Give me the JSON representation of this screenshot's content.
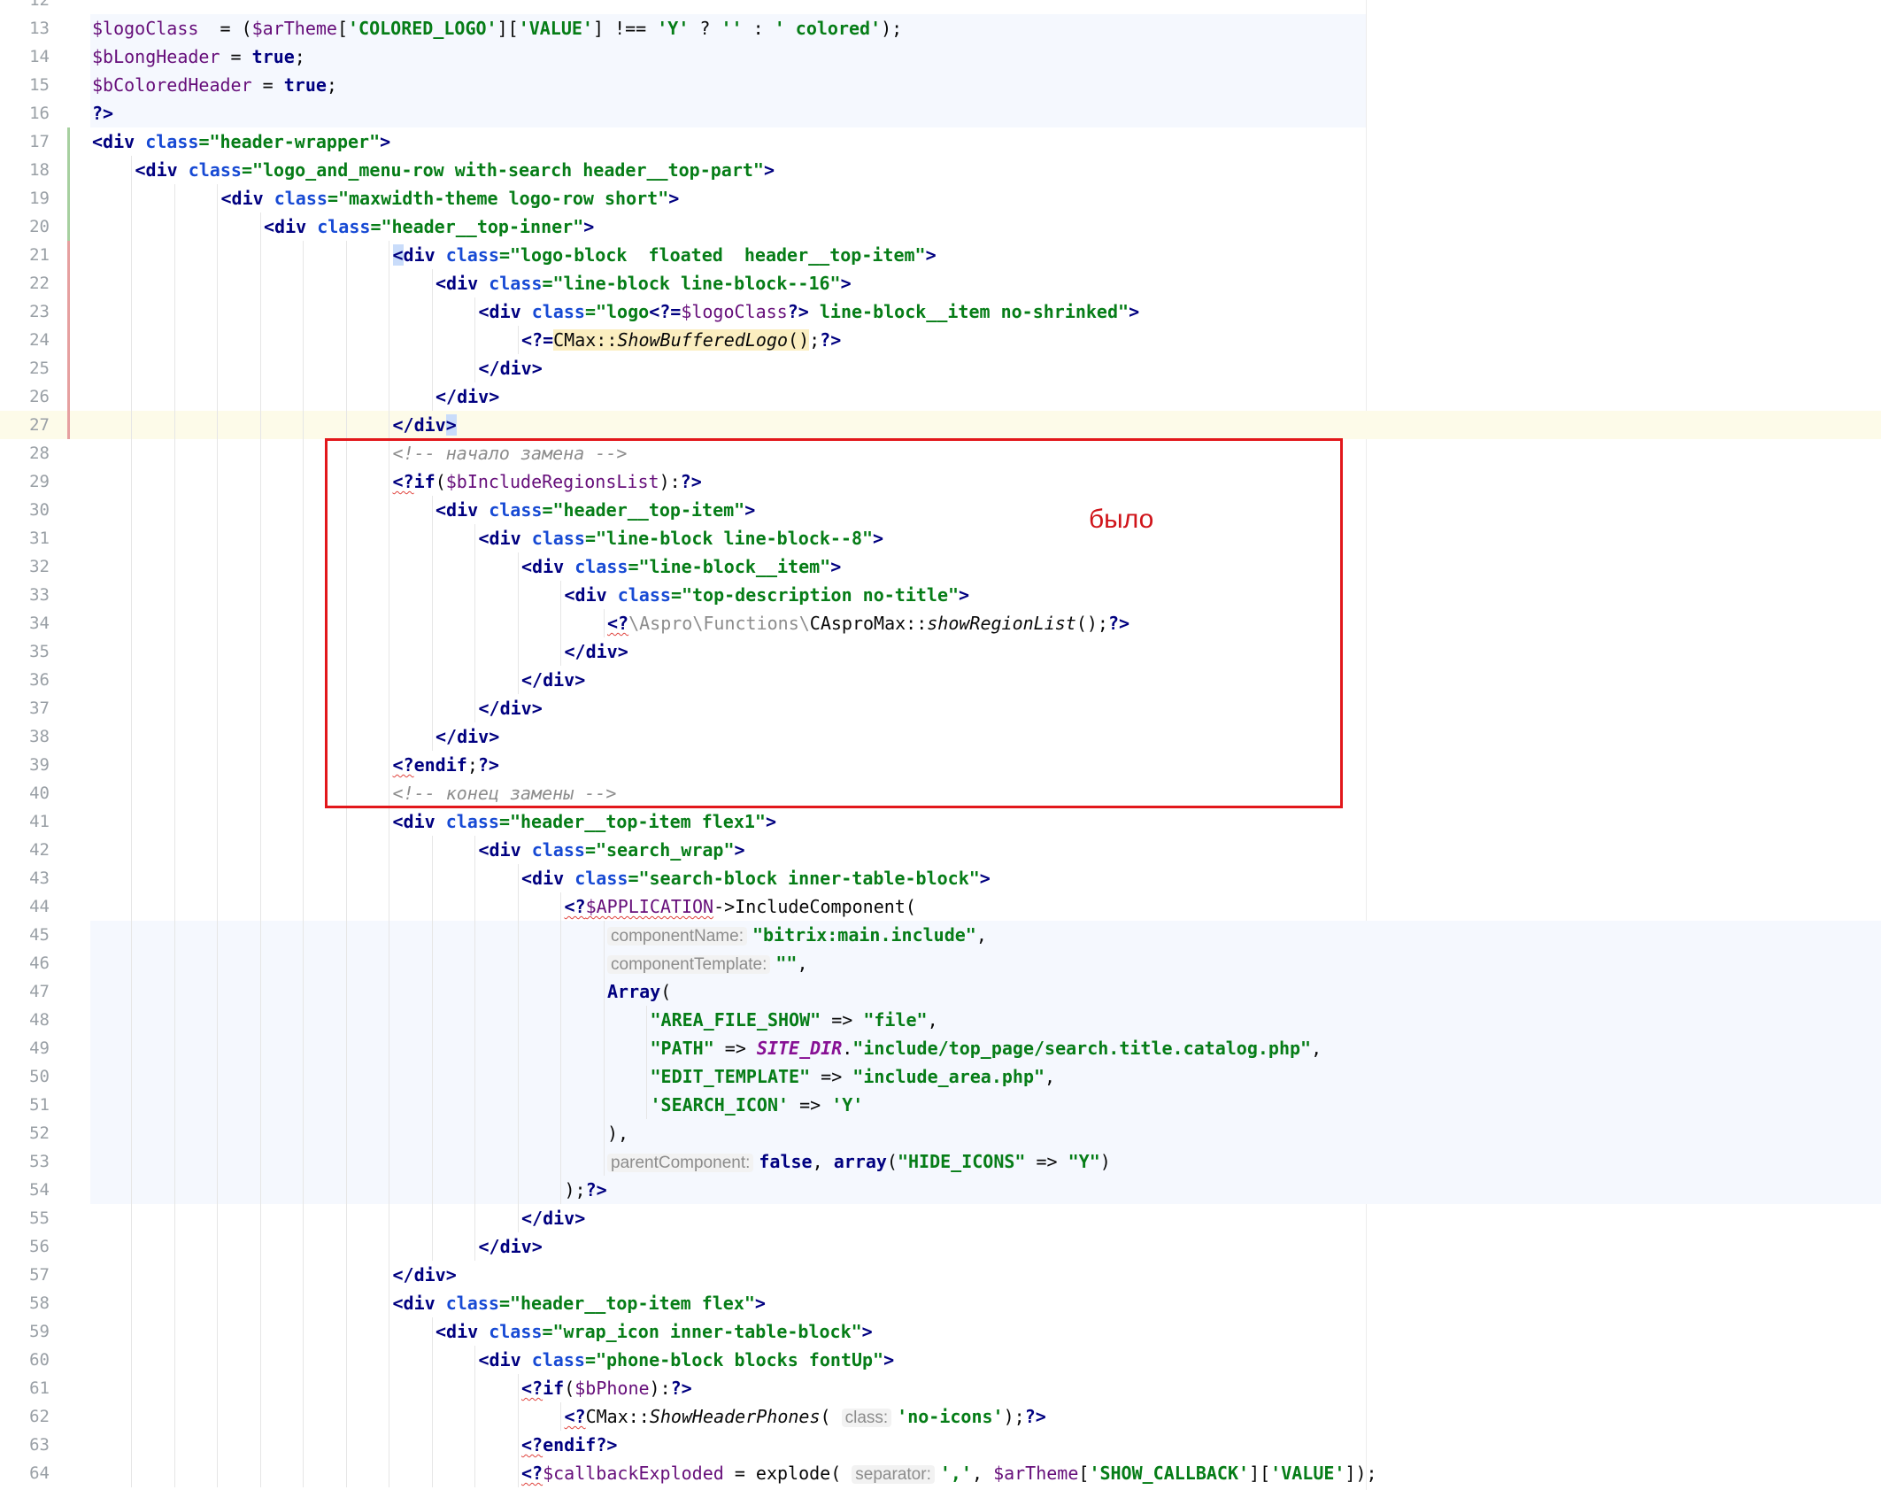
{
  "editor": {
    "annotation_label": "было",
    "lines": [
      {
        "n": "12",
        "indent": 0,
        "tokens": []
      },
      {
        "n": "13",
        "indent": 0,
        "tokens": [
          [
            "t-var",
            "$logoClass"
          ],
          [
            "",
            "  = ("
          ],
          [
            "t-var",
            "$arTheme"
          ],
          [
            "",
            "["
          ],
          [
            "t-str",
            "'COLORED_LOGO'"
          ],
          [
            "",
            "]["
          ],
          [
            "t-str",
            "'VALUE'"
          ],
          [
            "",
            "] !== "
          ],
          [
            "t-str",
            "'Y'"
          ],
          [
            "",
            " ? "
          ],
          [
            "t-str",
            "''"
          ],
          [
            "",
            " : "
          ],
          [
            "t-str",
            "' colored'"
          ],
          [
            "",
            ");"
          ]
        ]
      },
      {
        "n": "14",
        "indent": 0,
        "tokens": [
          [
            "t-var",
            "$bLongHeader"
          ],
          [
            "",
            " = "
          ],
          [
            "t-kw",
            "true"
          ],
          [
            "",
            ";"
          ]
        ]
      },
      {
        "n": "15",
        "indent": 0,
        "tokens": [
          [
            "t-var",
            "$bColoredHeader"
          ],
          [
            "",
            " = "
          ],
          [
            "t-kw",
            "true"
          ],
          [
            "",
            ";"
          ]
        ]
      },
      {
        "n": "16",
        "indent": 0,
        "tokens": [
          [
            "t-php",
            "?>"
          ]
        ]
      },
      {
        "n": "17",
        "indent": 0,
        "tokens": [
          [
            "t-tag",
            "<div"
          ],
          [
            "",
            " "
          ],
          [
            "t-attr",
            "class"
          ],
          [
            "t-str",
            "=\"header-wrapper\""
          ],
          [
            "t-tag",
            ">"
          ]
        ]
      },
      {
        "n": "18",
        "indent": 1,
        "tokens": [
          [
            "t-tag",
            "<div"
          ],
          [
            "",
            " "
          ],
          [
            "t-attr",
            "class"
          ],
          [
            "t-str",
            "=\"logo_and_menu-row with-search header__top-part\""
          ],
          [
            "t-tag",
            ">"
          ]
        ]
      },
      {
        "n": "19",
        "indent": 3,
        "tokens": [
          [
            "t-tag",
            "<div"
          ],
          [
            "",
            " "
          ],
          [
            "t-attr",
            "class"
          ],
          [
            "t-str",
            "=\"maxwidth-theme logo-row short\""
          ],
          [
            "t-tag",
            ">"
          ]
        ]
      },
      {
        "n": "20",
        "indent": 4,
        "tokens": [
          [
            "t-tag",
            "<div"
          ],
          [
            "",
            " "
          ],
          [
            "t-attr",
            "class"
          ],
          [
            "t-str",
            "=\"header__top-inner\""
          ],
          [
            "t-tag",
            ">"
          ]
        ]
      },
      {
        "n": "21",
        "indent": 7,
        "tokens": [
          [
            "t-tag t-sel",
            "<"
          ],
          [
            "t-tag",
            "div"
          ],
          [
            "",
            " "
          ],
          [
            "t-attr",
            "class"
          ],
          [
            "t-str",
            "=\"logo-block  floated  header__top-item\""
          ],
          [
            "t-tag",
            ">"
          ]
        ]
      },
      {
        "n": "22",
        "indent": 8,
        "tokens": [
          [
            "t-tag",
            "<div"
          ],
          [
            "",
            " "
          ],
          [
            "t-attr",
            "class"
          ],
          [
            "t-str",
            "=\"line-block line-block--16\""
          ],
          [
            "t-tag",
            ">"
          ]
        ]
      },
      {
        "n": "23",
        "indent": 9,
        "tokens": [
          [
            "t-tag",
            "<div"
          ],
          [
            "",
            " "
          ],
          [
            "t-attr",
            "class"
          ],
          [
            "t-str",
            "=\"logo"
          ],
          [
            "t-php",
            "<?="
          ],
          [
            "t-var",
            "$logoClass"
          ],
          [
            "t-php",
            "?>"
          ],
          [
            "t-str",
            " line-block__item no-shrinked\""
          ],
          [
            "t-tag",
            ">"
          ]
        ]
      },
      {
        "n": "24",
        "indent": 10,
        "tokens": [
          [
            "t-php",
            "<?="
          ],
          [
            "t-hl",
            "CMax::"
          ],
          [
            "t-hl t-it",
            "ShowBufferedLogo"
          ],
          [
            "t-hl",
            "()"
          ],
          [
            "",
            ";"
          ],
          [
            "t-php",
            "?>"
          ]
        ]
      },
      {
        "n": "25",
        "indent": 9,
        "tokens": [
          [
            "t-tag",
            "</div>"
          ]
        ]
      },
      {
        "n": "26",
        "indent": 8,
        "tokens": [
          [
            "t-tag",
            "</div>"
          ]
        ]
      },
      {
        "n": "27",
        "indent": 7,
        "tokens": [
          [
            "t-tag",
            "</div"
          ],
          [
            "t-tag t-sel",
            ">"
          ]
        ]
      },
      {
        "n": "28",
        "indent": 7,
        "tokens": [
          [
            "t-cmt",
            "<!-- начало замена -->"
          ]
        ]
      },
      {
        "n": "29",
        "indent": 7,
        "tokens": [
          [
            "t-php t-sq",
            "<?"
          ],
          [
            "t-kw",
            "if"
          ],
          [
            "",
            "("
          ],
          [
            "t-var",
            "$bIncludeRegionsList"
          ],
          [
            "",
            "):"
          ],
          [
            "t-php",
            "?>"
          ]
        ]
      },
      {
        "n": "30",
        "indent": 8,
        "tokens": [
          [
            "t-tag",
            "<div"
          ],
          [
            "",
            " "
          ],
          [
            "t-attr",
            "class"
          ],
          [
            "t-str",
            "=\"header__top-item\""
          ],
          [
            "t-tag",
            ">"
          ]
        ]
      },
      {
        "n": "31",
        "indent": 9,
        "tokens": [
          [
            "t-tag",
            "<div"
          ],
          [
            "",
            " "
          ],
          [
            "t-attr",
            "class"
          ],
          [
            "t-str",
            "=\"line-block line-block--8\""
          ],
          [
            "t-tag",
            ">"
          ]
        ]
      },
      {
        "n": "32",
        "indent": 10,
        "tokens": [
          [
            "t-tag",
            "<div"
          ],
          [
            "",
            " "
          ],
          [
            "t-attr",
            "class"
          ],
          [
            "t-str",
            "=\"line-block__item\""
          ],
          [
            "t-tag",
            ">"
          ]
        ]
      },
      {
        "n": "33",
        "indent": 11,
        "tokens": [
          [
            "t-tag",
            "<div"
          ],
          [
            "",
            " "
          ],
          [
            "t-attr",
            "class"
          ],
          [
            "t-str",
            "=\"top-description no-title\""
          ],
          [
            "t-tag",
            ">"
          ]
        ]
      },
      {
        "n": "34",
        "indent": 12,
        "tokens": [
          [
            "t-php t-sq",
            "<?"
          ],
          [
            "t-ns",
            "\\Aspro\\Functions\\"
          ],
          [
            "",
            "CAsproMax::"
          ],
          [
            "t-it",
            "showRegionList"
          ],
          [
            "",
            "();"
          ],
          [
            "t-php",
            "?>"
          ]
        ]
      },
      {
        "n": "35",
        "indent": 11,
        "tokens": [
          [
            "t-tag",
            "</div>"
          ]
        ]
      },
      {
        "n": "36",
        "indent": 10,
        "tokens": [
          [
            "t-tag",
            "</div>"
          ]
        ]
      },
      {
        "n": "37",
        "indent": 9,
        "tokens": [
          [
            "t-tag",
            "</div>"
          ]
        ]
      },
      {
        "n": "38",
        "indent": 8,
        "tokens": [
          [
            "t-tag",
            "</div>"
          ]
        ]
      },
      {
        "n": "39",
        "indent": 7,
        "tokens": [
          [
            "t-php t-sq",
            "<?"
          ],
          [
            "t-kw",
            "endif"
          ],
          [
            "",
            ";"
          ],
          [
            "t-php",
            "?>"
          ]
        ]
      },
      {
        "n": "40",
        "indent": 7,
        "tokens": [
          [
            "t-cmt",
            "<!-- конец замены -->"
          ]
        ]
      },
      {
        "n": "41",
        "indent": 7,
        "tokens": [
          [
            "t-tag",
            "<div"
          ],
          [
            "",
            " "
          ],
          [
            "t-attr",
            "class"
          ],
          [
            "t-str",
            "=\"header__top-item flex1\""
          ],
          [
            "t-tag",
            ">"
          ]
        ]
      },
      {
        "n": "42",
        "indent": 9,
        "tokens": [
          [
            "t-tag",
            "<div"
          ],
          [
            "",
            " "
          ],
          [
            "t-attr",
            "class"
          ],
          [
            "t-str",
            "=\"search_wrap\""
          ],
          [
            "t-tag",
            ">"
          ]
        ]
      },
      {
        "n": "43",
        "indent": 10,
        "tokens": [
          [
            "t-tag",
            "<div"
          ],
          [
            "",
            " "
          ],
          [
            "t-attr",
            "class"
          ],
          [
            "t-str",
            "=\"search-block inner-table-block\""
          ],
          [
            "t-tag",
            ">"
          ]
        ]
      },
      {
        "n": "44",
        "indent": 11,
        "tokens": [
          [
            "t-php t-sq",
            "<?"
          ],
          [
            "t-var t-sq",
            "$APPLICATION"
          ],
          [
            "",
            "->IncludeComponent("
          ]
        ]
      },
      {
        "n": "45",
        "indent": 12,
        "tokens": [
          [
            "hint",
            "componentName:"
          ],
          [
            "t-str",
            "\"bitrix:main.include\""
          ],
          [
            "",
            ","
          ]
        ]
      },
      {
        "n": "46",
        "indent": 12,
        "tokens": [
          [
            "hint",
            "componentTemplate:"
          ],
          [
            "t-str",
            "\"\""
          ],
          [
            "",
            ","
          ]
        ]
      },
      {
        "n": "47",
        "indent": 12,
        "tokens": [
          [
            "t-kw",
            "Array"
          ],
          [
            "",
            "("
          ]
        ]
      },
      {
        "n": "48",
        "indent": 13,
        "tokens": [
          [
            "t-str",
            "\"AREA_FILE_SHOW\""
          ],
          [
            "",
            " => "
          ],
          [
            "t-str",
            "\"file\""
          ],
          [
            "",
            ","
          ]
        ]
      },
      {
        "n": "49",
        "indent": 13,
        "tokens": [
          [
            "t-str",
            "\"PATH\""
          ],
          [
            "",
            " => "
          ],
          [
            "t-const",
            "SITE_DIR"
          ],
          [
            "",
            "."
          ],
          [
            "t-str",
            "\"include/top_page/search.title.catalog.php\""
          ],
          [
            "",
            ","
          ]
        ]
      },
      {
        "n": "50",
        "indent": 13,
        "tokens": [
          [
            "t-str",
            "\"EDIT_TEMPLATE\""
          ],
          [
            "",
            " => "
          ],
          [
            "t-str",
            "\"include_area.php\""
          ],
          [
            "",
            ","
          ]
        ]
      },
      {
        "n": "51",
        "indent": 13,
        "tokens": [
          [
            "t-str",
            "'SEARCH_ICON'"
          ],
          [
            "",
            " => "
          ],
          [
            "t-str",
            "'Y'"
          ]
        ]
      },
      {
        "n": "52",
        "indent": 12,
        "tokens": [
          [
            "",
            "),"
          ]
        ]
      },
      {
        "n": "53",
        "indent": 12,
        "tokens": [
          [
            "hint",
            "parentComponent:"
          ],
          [
            "t-kw",
            "false"
          ],
          [
            "",
            ", "
          ],
          [
            "t-kw",
            "array"
          ],
          [
            "",
            "("
          ],
          [
            "t-str",
            "\"HIDE_ICONS\""
          ],
          [
            "",
            " => "
          ],
          [
            "t-str",
            "\"Y\""
          ],
          [
            "",
            ")"
          ]
        ]
      },
      {
        "n": "54",
        "indent": 11,
        "tokens": [
          [
            "",
            ");"
          ],
          [
            "t-php",
            "?>"
          ]
        ]
      },
      {
        "n": "55",
        "indent": 10,
        "tokens": [
          [
            "t-tag",
            "</div>"
          ]
        ]
      },
      {
        "n": "56",
        "indent": 9,
        "tokens": [
          [
            "t-tag",
            "</div>"
          ]
        ]
      },
      {
        "n": "57",
        "indent": 7,
        "tokens": [
          [
            "t-tag",
            "</div>"
          ]
        ]
      },
      {
        "n": "58",
        "indent": 7,
        "tokens": [
          [
            "t-tag",
            "<div"
          ],
          [
            "",
            " "
          ],
          [
            "t-attr",
            "class"
          ],
          [
            "t-str",
            "=\"header__top-item flex\""
          ],
          [
            "t-tag",
            ">"
          ]
        ]
      },
      {
        "n": "59",
        "indent": 8,
        "tokens": [
          [
            "t-tag",
            "<div"
          ],
          [
            "",
            " "
          ],
          [
            "t-attr",
            "class"
          ],
          [
            "t-str",
            "=\"wrap_icon inner-table-block\""
          ],
          [
            "t-tag",
            ">"
          ]
        ]
      },
      {
        "n": "60",
        "indent": 9,
        "tokens": [
          [
            "t-tag",
            "<div"
          ],
          [
            "",
            " "
          ],
          [
            "t-attr",
            "class"
          ],
          [
            "t-str",
            "=\"phone-block blocks fontUp\""
          ],
          [
            "t-tag",
            ">"
          ]
        ]
      },
      {
        "n": "61",
        "indent": 10,
        "tokens": [
          [
            "t-php t-sq",
            "<?"
          ],
          [
            "t-kw",
            "if"
          ],
          [
            "",
            "("
          ],
          [
            "t-var",
            "$bPhone"
          ],
          [
            "",
            "):"
          ],
          [
            "t-php",
            "?>"
          ]
        ]
      },
      {
        "n": "62",
        "indent": 11,
        "tokens": [
          [
            "t-php t-sq",
            "<?"
          ],
          [
            "",
            "CMax::"
          ],
          [
            "t-it",
            "ShowHeaderPhones"
          ],
          [
            "",
            "( "
          ],
          [
            "hint",
            "class:"
          ],
          [
            "t-str",
            "'no-icons'"
          ],
          [
            "",
            ");"
          ],
          [
            "t-php",
            "?>"
          ]
        ]
      },
      {
        "n": "63",
        "indent": 10,
        "tokens": [
          [
            "t-php t-sq",
            "<?"
          ],
          [
            "t-kw",
            "endif"
          ],
          [
            "t-php",
            "?>"
          ]
        ]
      },
      {
        "n": "64",
        "indent": 10,
        "tokens": [
          [
            "t-php t-sq",
            "<?"
          ],
          [
            "t-var",
            "$callbackExploded"
          ],
          [
            "",
            " = explode( "
          ],
          [
            "hint",
            "separator:"
          ],
          [
            "t-str",
            "','"
          ],
          [
            "",
            ", "
          ],
          [
            "t-var",
            "$arTheme"
          ],
          [
            "",
            "["
          ],
          [
            "t-str",
            "'SHOW_CALLBACK'"
          ],
          [
            "",
            "]["
          ],
          [
            "t-str",
            "'VALUE'"
          ],
          [
            "",
            "]);"
          ]
        ]
      }
    ]
  }
}
